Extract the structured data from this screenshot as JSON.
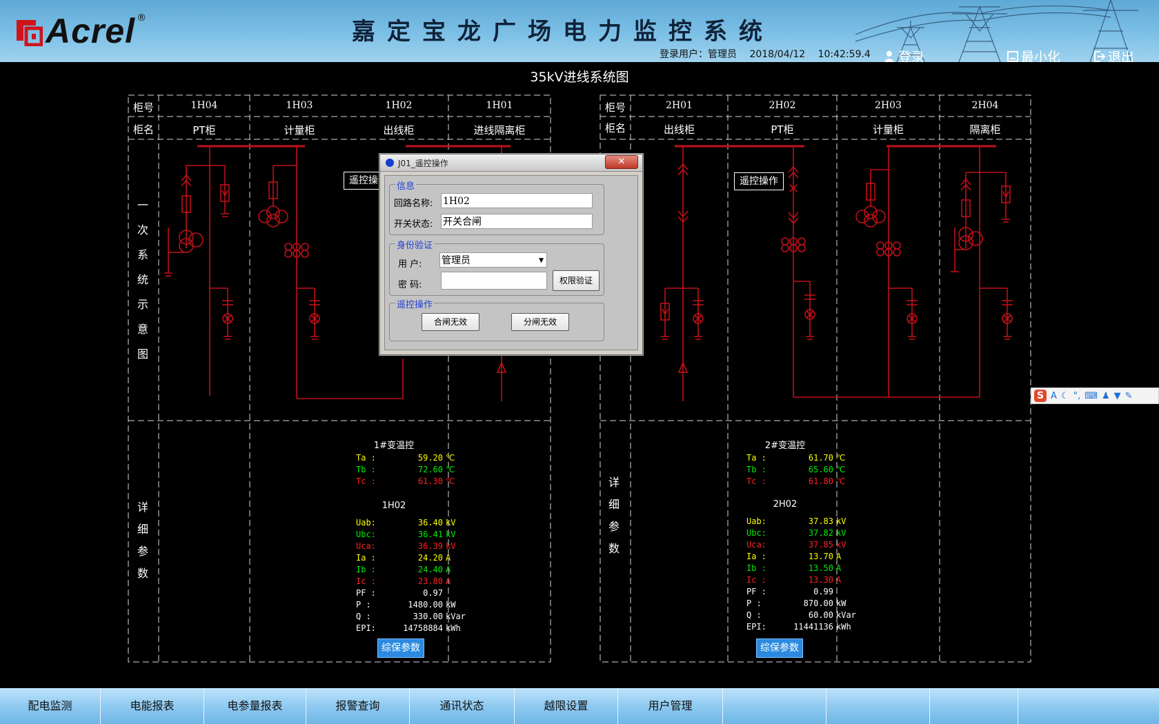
{
  "header": {
    "logo_text": "Acrel",
    "logo_reg": "®",
    "system_title": "嘉定宝龙广场电力监控系统",
    "login_label": "登录用户：",
    "login_user": "管理员",
    "date": "2018/04/12",
    "time": "10:42:59.4",
    "login_btn": "登录",
    "minimize_btn": "最小化",
    "exit_btn": "退出"
  },
  "page_title": "35kV进线系统图",
  "left_panel": {
    "row_headers": [
      "柜号",
      "柜名"
    ],
    "cabinet_numbers": [
      "1H04",
      "1H03",
      "1H02",
      "1H01"
    ],
    "cabinet_names": [
      "PT柜",
      "计量柜",
      "出线柜",
      "进线隔离柜"
    ],
    "primary_label": [
      "一",
      "次",
      "系",
      "统",
      "示",
      "意",
      "图"
    ],
    "detail_label": [
      "详",
      "细",
      "参",
      "数"
    ],
    "remote_btn": "遥控操作",
    "temp_title": "1#变温控",
    "temps": [
      {
        "label": "Ta :",
        "value": "59.20",
        "unit": "℃"
      },
      {
        "label": "Tb :",
        "value": "72.60",
        "unit": "℃"
      },
      {
        "label": "Tc :",
        "value": "61.30",
        "unit": "℃"
      }
    ],
    "circuit_title": "1H02",
    "params": [
      {
        "label": "Uab:",
        "value": "36.40",
        "unit": "kV"
      },
      {
        "label": "Ubc:",
        "value": "36.41",
        "unit": "kV"
      },
      {
        "label": "Uca:",
        "value": "36.39",
        "unit": "kV"
      },
      {
        "label": "Ia :",
        "value": "24.20",
        "unit": "A"
      },
      {
        "label": "Ib :",
        "value": "24.40",
        "unit": "A"
      },
      {
        "label": "Ic :",
        "value": "23.80",
        "unit": "A"
      },
      {
        "label": "PF :",
        "value": "0.97",
        "unit": ""
      },
      {
        "label": "P  :",
        "value": "1480.00",
        "unit": "kW"
      },
      {
        "label": "Q  :",
        "value": "330.00",
        "unit": "kVar"
      },
      {
        "label": "EPI:",
        "value": "14758884",
        "unit": "kWh"
      }
    ],
    "protect_btn": "综保参数"
  },
  "right_panel": {
    "row_headers": [
      "柜号",
      "柜名"
    ],
    "cabinet_numbers": [
      "2H01",
      "2H02",
      "2H03",
      "2H04"
    ],
    "cabinet_names": [
      "出线柜",
      "PT柜",
      "计量柜",
      "隔离柜"
    ],
    "detail_label": [
      "详",
      "细",
      "参",
      "数"
    ],
    "remote_btn": "遥控操作",
    "temp_title": "2#变温控",
    "temps": [
      {
        "label": "Ta :",
        "value": "61.70",
        "unit": "℃"
      },
      {
        "label": "Tb :",
        "value": "65.60",
        "unit": "℃"
      },
      {
        "label": "Tc :",
        "value": "61.80",
        "unit": "℃"
      }
    ],
    "circuit_title": "2H02",
    "params": [
      {
        "label": "Uab:",
        "value": "37.83",
        "unit": "kV"
      },
      {
        "label": "Ubc:",
        "value": "37.82",
        "unit": "kV"
      },
      {
        "label": "Uca:",
        "value": "37.85",
        "unit": "kV"
      },
      {
        "label": "Ia :",
        "value": "13.70",
        "unit": "A"
      },
      {
        "label": "Ib :",
        "value": "13.50",
        "unit": "A"
      },
      {
        "label": "Ic :",
        "value": "13.30",
        "unit": "A"
      },
      {
        "label": "PF :",
        "value": "0.99",
        "unit": ""
      },
      {
        "label": "P  :",
        "value": "870.00",
        "unit": "kW"
      },
      {
        "label": "Q  :",
        "value": "60.00",
        "unit": "kVar"
      },
      {
        "label": "EPI:",
        "value": "11441136",
        "unit": "kWh"
      }
    ],
    "protect_btn": "综保参数"
  },
  "dialog": {
    "title": "J01_遥控操作",
    "close": "✕",
    "info_group": "信息",
    "circuit_label": "回路名称:",
    "circuit_value": "1H02",
    "status_label": "开关状态:",
    "status_value": "开关合闸",
    "auth_group": "身份验证",
    "user_label": "用  户:",
    "user_value": "管理员",
    "pwd_label": "密  码:",
    "verify_btn": "权限验证",
    "remote_group": "遥控操作",
    "close_btn": "合闸无效",
    "open_btn": "分闸无效"
  },
  "colors": {
    "phase_a": "#ffff00",
    "phase_b": "#00ee00",
    "phase_c": "#ff2222",
    "line": "#c0101a"
  },
  "nav": [
    "配电监测",
    "电能报表",
    "电参量报表",
    "报警查询",
    "通讯状态",
    "越限设置",
    "用户管理",
    "",
    "",
    "",
    ""
  ],
  "ime": {
    "logo": "S",
    "text": "A"
  }
}
